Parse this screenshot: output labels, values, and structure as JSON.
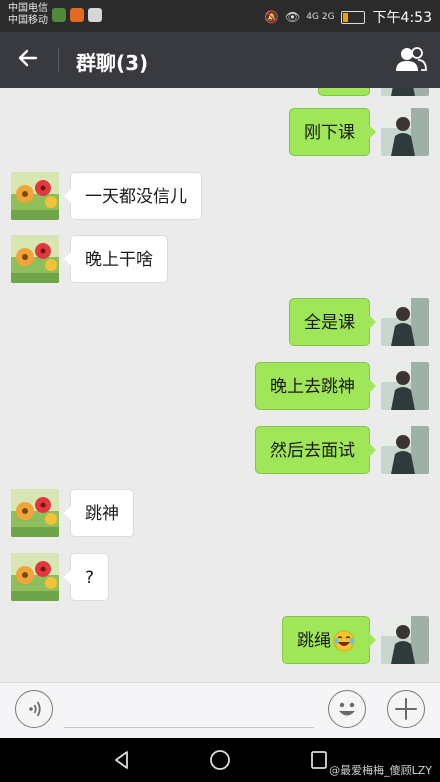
{
  "status_bar": {
    "carrier_1": "中国电信",
    "carrier_2": "中国移动",
    "time": "下午4:53",
    "network_label": "4G 2G",
    "battery_level": 0.25
  },
  "header": {
    "title": "群聊(3)"
  },
  "messages": [
    {
      "side": "right",
      "text": "刚下课"
    },
    {
      "side": "left",
      "text": "一天都没信儿"
    },
    {
      "side": "left",
      "text": "晚上干啥"
    },
    {
      "side": "right",
      "text": "全是课"
    },
    {
      "side": "right",
      "text": "晚上去跳神"
    },
    {
      "side": "right",
      "text": "然后去面试"
    },
    {
      "side": "left",
      "text": "跳神"
    },
    {
      "side": "left",
      "text": "?"
    },
    {
      "side": "right",
      "text": "跳绳"
    }
  ],
  "watermark": "@最爱梅梅_傻顾LZY",
  "colors": {
    "bubble_self": "#9fe658",
    "bubble_other": "#ffffff",
    "header_bg": "#393a3f",
    "chat_bg": "#ebebeb"
  }
}
